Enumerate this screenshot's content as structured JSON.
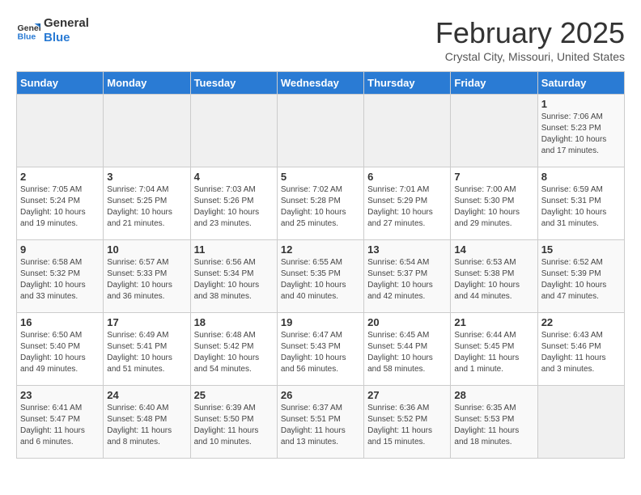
{
  "header": {
    "logo_line1": "General",
    "logo_line2": "Blue",
    "title": "February 2025",
    "subtitle": "Crystal City, Missouri, United States"
  },
  "days_of_week": [
    "Sunday",
    "Monday",
    "Tuesday",
    "Wednesday",
    "Thursday",
    "Friday",
    "Saturday"
  ],
  "weeks": [
    [
      {
        "day": "",
        "info": ""
      },
      {
        "day": "",
        "info": ""
      },
      {
        "day": "",
        "info": ""
      },
      {
        "day": "",
        "info": ""
      },
      {
        "day": "",
        "info": ""
      },
      {
        "day": "",
        "info": ""
      },
      {
        "day": "1",
        "info": "Sunrise: 7:06 AM\nSunset: 5:23 PM\nDaylight: 10 hours\nand 17 minutes."
      }
    ],
    [
      {
        "day": "2",
        "info": "Sunrise: 7:05 AM\nSunset: 5:24 PM\nDaylight: 10 hours\nand 19 minutes."
      },
      {
        "day": "3",
        "info": "Sunrise: 7:04 AM\nSunset: 5:25 PM\nDaylight: 10 hours\nand 21 minutes."
      },
      {
        "day": "4",
        "info": "Sunrise: 7:03 AM\nSunset: 5:26 PM\nDaylight: 10 hours\nand 23 minutes."
      },
      {
        "day": "5",
        "info": "Sunrise: 7:02 AM\nSunset: 5:28 PM\nDaylight: 10 hours\nand 25 minutes."
      },
      {
        "day": "6",
        "info": "Sunrise: 7:01 AM\nSunset: 5:29 PM\nDaylight: 10 hours\nand 27 minutes."
      },
      {
        "day": "7",
        "info": "Sunrise: 7:00 AM\nSunset: 5:30 PM\nDaylight: 10 hours\nand 29 minutes."
      },
      {
        "day": "8",
        "info": "Sunrise: 6:59 AM\nSunset: 5:31 PM\nDaylight: 10 hours\nand 31 minutes."
      }
    ],
    [
      {
        "day": "9",
        "info": "Sunrise: 6:58 AM\nSunset: 5:32 PM\nDaylight: 10 hours\nand 33 minutes."
      },
      {
        "day": "10",
        "info": "Sunrise: 6:57 AM\nSunset: 5:33 PM\nDaylight: 10 hours\nand 36 minutes."
      },
      {
        "day": "11",
        "info": "Sunrise: 6:56 AM\nSunset: 5:34 PM\nDaylight: 10 hours\nand 38 minutes."
      },
      {
        "day": "12",
        "info": "Sunrise: 6:55 AM\nSunset: 5:35 PM\nDaylight: 10 hours\nand 40 minutes."
      },
      {
        "day": "13",
        "info": "Sunrise: 6:54 AM\nSunset: 5:37 PM\nDaylight: 10 hours\nand 42 minutes."
      },
      {
        "day": "14",
        "info": "Sunrise: 6:53 AM\nSunset: 5:38 PM\nDaylight: 10 hours\nand 44 minutes."
      },
      {
        "day": "15",
        "info": "Sunrise: 6:52 AM\nSunset: 5:39 PM\nDaylight: 10 hours\nand 47 minutes."
      }
    ],
    [
      {
        "day": "16",
        "info": "Sunrise: 6:50 AM\nSunset: 5:40 PM\nDaylight: 10 hours\nand 49 minutes."
      },
      {
        "day": "17",
        "info": "Sunrise: 6:49 AM\nSunset: 5:41 PM\nDaylight: 10 hours\nand 51 minutes."
      },
      {
        "day": "18",
        "info": "Sunrise: 6:48 AM\nSunset: 5:42 PM\nDaylight: 10 hours\nand 54 minutes."
      },
      {
        "day": "19",
        "info": "Sunrise: 6:47 AM\nSunset: 5:43 PM\nDaylight: 10 hours\nand 56 minutes."
      },
      {
        "day": "20",
        "info": "Sunrise: 6:45 AM\nSunset: 5:44 PM\nDaylight: 10 hours\nand 58 minutes."
      },
      {
        "day": "21",
        "info": "Sunrise: 6:44 AM\nSunset: 5:45 PM\nDaylight: 11 hours\nand 1 minute."
      },
      {
        "day": "22",
        "info": "Sunrise: 6:43 AM\nSunset: 5:46 PM\nDaylight: 11 hours\nand 3 minutes."
      }
    ],
    [
      {
        "day": "23",
        "info": "Sunrise: 6:41 AM\nSunset: 5:47 PM\nDaylight: 11 hours\nand 6 minutes."
      },
      {
        "day": "24",
        "info": "Sunrise: 6:40 AM\nSunset: 5:48 PM\nDaylight: 11 hours\nand 8 minutes."
      },
      {
        "day": "25",
        "info": "Sunrise: 6:39 AM\nSunset: 5:50 PM\nDaylight: 11 hours\nand 10 minutes."
      },
      {
        "day": "26",
        "info": "Sunrise: 6:37 AM\nSunset: 5:51 PM\nDaylight: 11 hours\nand 13 minutes."
      },
      {
        "day": "27",
        "info": "Sunrise: 6:36 AM\nSunset: 5:52 PM\nDaylight: 11 hours\nand 15 minutes."
      },
      {
        "day": "28",
        "info": "Sunrise: 6:35 AM\nSunset: 5:53 PM\nDaylight: 11 hours\nand 18 minutes."
      },
      {
        "day": "",
        "info": ""
      }
    ]
  ]
}
